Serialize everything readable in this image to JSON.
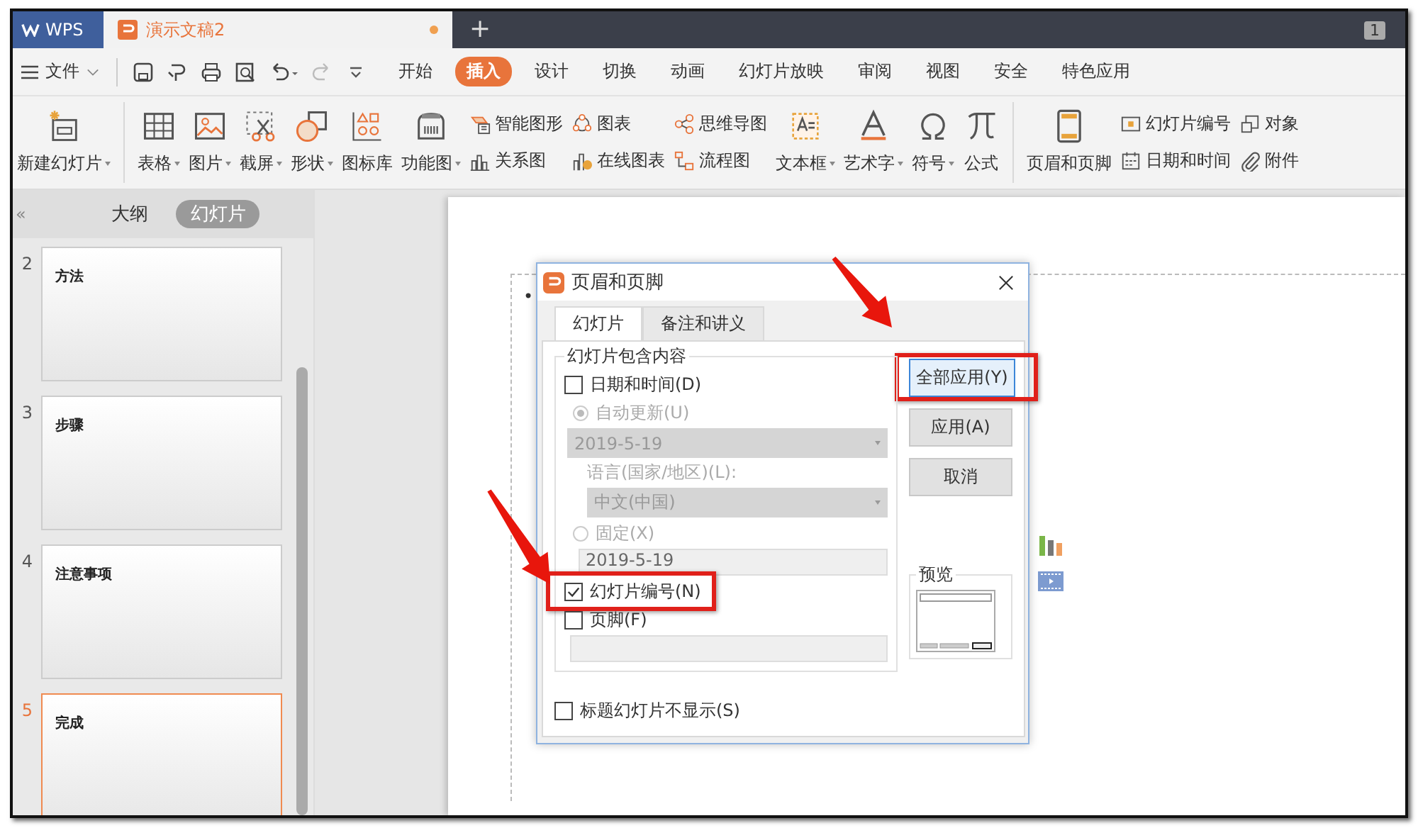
{
  "title_bar": {
    "tabs": [
      {
        "label": "WPS",
        "kind": "app",
        "selected": false
      },
      {
        "label": "演示文稿2",
        "kind": "document",
        "selected": true,
        "unsaved": true
      }
    ],
    "new_tab": "+",
    "window_badge": "1"
  },
  "menu": {
    "file": "文件",
    "tabs": [
      {
        "label": "开始",
        "selected": false
      },
      {
        "label": "插入",
        "selected": true
      },
      {
        "label": "设计",
        "selected": false
      },
      {
        "label": "切换",
        "selected": false
      },
      {
        "label": "动画",
        "selected": false
      },
      {
        "label": "幻灯片放映",
        "selected": false
      },
      {
        "label": "审阅",
        "selected": false
      },
      {
        "label": "视图",
        "selected": false
      },
      {
        "label": "安全",
        "selected": false
      },
      {
        "label": "特色应用",
        "selected": false
      }
    ]
  },
  "ribbon": [
    {
      "kind": "large",
      "label": "新建幻灯片",
      "dropdown": true
    },
    {
      "kind": "separator"
    },
    {
      "kind": "large",
      "label": "表格",
      "dropdown": true
    },
    {
      "kind": "large",
      "label": "图片",
      "dropdown": true
    },
    {
      "kind": "large",
      "label": "截屏",
      "dropdown": true
    },
    {
      "kind": "large",
      "label": "形状",
      "dropdown": true
    },
    {
      "kind": "large",
      "label": "图标库",
      "dropdown": false
    },
    {
      "kind": "large",
      "label": "功能图",
      "dropdown": true
    },
    {
      "kind": "pair",
      "items": [
        {
          "label": "智能图形"
        },
        {
          "label": "关系图"
        }
      ]
    },
    {
      "kind": "pair",
      "items": [
        {
          "label": "图表"
        },
        {
          "label": "在线图表"
        }
      ]
    },
    {
      "kind": "pair",
      "items": [
        {
          "label": "思维导图"
        },
        {
          "label": "流程图"
        }
      ]
    },
    {
      "kind": "large",
      "label": "文本框",
      "dropdown": true
    },
    {
      "kind": "large",
      "label": "艺术字",
      "dropdown": true
    },
    {
      "kind": "large",
      "label": "符号",
      "dropdown": true
    },
    {
      "kind": "large",
      "label": "公式",
      "dropdown": false
    },
    {
      "kind": "separator"
    },
    {
      "kind": "large",
      "label": "页眉和页脚",
      "dropdown": false
    },
    {
      "kind": "pair",
      "items": [
        {
          "label": "幻灯片编号"
        },
        {
          "label": "日期和时间"
        }
      ]
    },
    {
      "kind": "pair",
      "items": [
        {
          "label": "对象"
        },
        {
          "label": "附件"
        }
      ]
    }
  ],
  "side_panel": {
    "collapse": "«",
    "tabs": [
      {
        "label": "大纲",
        "selected": false
      },
      {
        "label": "幻灯片",
        "selected": true
      }
    ],
    "slides": [
      {
        "number": "2",
        "title": "方法",
        "selected": false
      },
      {
        "number": "3",
        "title": "步骤",
        "selected": false
      },
      {
        "number": "4",
        "title": "注意事项",
        "selected": false
      },
      {
        "number": "5",
        "title": "完成",
        "selected": true
      }
    ]
  },
  "slide": {
    "bullet": "•"
  },
  "dialog": {
    "title": "页眉和页脚",
    "tabs": [
      {
        "label": "幻灯片",
        "selected": true
      },
      {
        "label": "备注和讲义",
        "selected": false
      }
    ],
    "group_title": "幻灯片包含内容",
    "date_time": {
      "label": "日期和时间(D)",
      "checked": false
    },
    "auto_update": {
      "label": "自动更新(U)",
      "selected": true,
      "disabled": true,
      "value": "2019-5-19"
    },
    "language": {
      "label": "语言(国家/地区)(L):",
      "value": "中文(中国)",
      "disabled": true
    },
    "fixed": {
      "label": "固定(X)",
      "selected": false,
      "disabled": true,
      "value": "2019-5-19"
    },
    "slide_number": {
      "label": "幻灯片编号(N)",
      "checked": true
    },
    "footer": {
      "label": "页脚(F)",
      "checked": false
    },
    "hide_on_title": {
      "label": "标题幻灯片不显示(S)",
      "checked": false
    },
    "buttons": [
      {
        "label": "全部应用(Y)",
        "default": true
      },
      {
        "label": "应用(A)",
        "default": false
      },
      {
        "label": "取消",
        "default": false
      }
    ],
    "preview": {
      "title": "预览"
    }
  }
}
